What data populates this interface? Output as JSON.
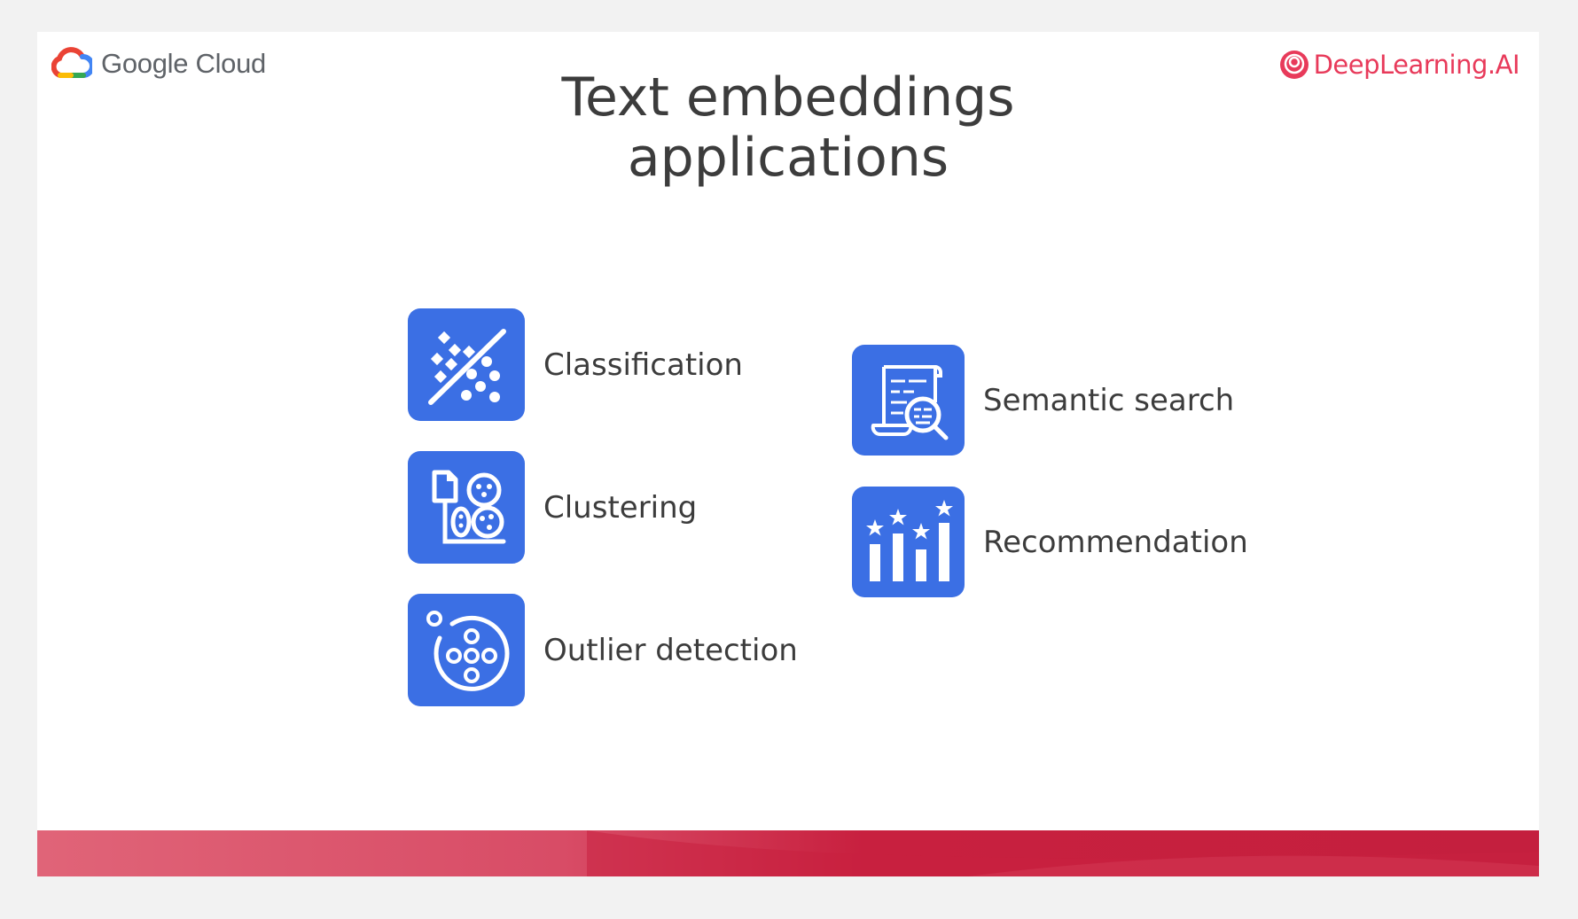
{
  "logos": {
    "left_text": "Google Cloud",
    "right_text": "DeepLearning.AI",
    "right_color": "#e83a5a"
  },
  "title": {
    "line1": "Text embeddings",
    "line2": "applications"
  },
  "applications": {
    "classification": {
      "label": "Classification",
      "icon": "scatter-divider-icon"
    },
    "clustering": {
      "label": "Clustering",
      "icon": "cluster-icon"
    },
    "outlier": {
      "label": "Outlier detection",
      "icon": "outlier-icon"
    },
    "semantic_search": {
      "label": "Semantic search",
      "icon": "document-search-icon"
    },
    "recommendation": {
      "label": "Recommendation",
      "icon": "star-bars-icon"
    }
  },
  "colors": {
    "icon_bg": "#3b6fe4",
    "footer": "#c8203f",
    "text": "#3c3c3c"
  }
}
